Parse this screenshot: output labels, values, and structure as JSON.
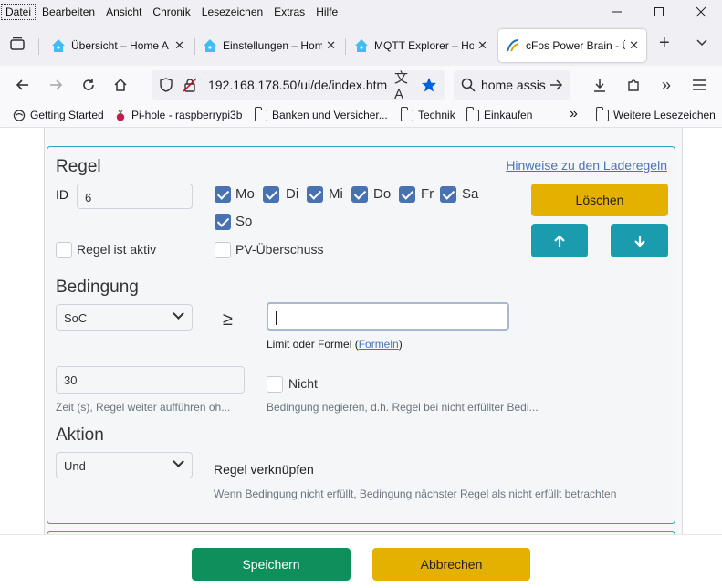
{
  "menu": [
    "Datei",
    "Bearbeiten",
    "Ansicht",
    "Chronik",
    "Lesezeichen",
    "Extras",
    "Hilfe"
  ],
  "tabs": [
    {
      "title": "Übersicht – Home A"
    },
    {
      "title": "Einstellungen – Hom"
    },
    {
      "title": "MQTT Explorer – Hor"
    },
    {
      "title": "cFos Power Brain - Ü"
    }
  ],
  "nav": {
    "url": "192.168.178.50/ui/de/index.htm",
    "search": "home assis"
  },
  "bookmarks": [
    {
      "label": "Getting Started",
      "icon": "firefox-icon"
    },
    {
      "label": "Pi-hole - raspberrypi3b",
      "icon": "raspberry-icon"
    },
    {
      "label": "Banken und Versicher...",
      "icon": "folder-icon"
    },
    {
      "label": "Technik",
      "icon": "folder-icon"
    },
    {
      "label": "Einkaufen",
      "icon": "folder-icon"
    },
    {
      "label": "Weitere Lesezeichen",
      "icon": "folder-icon"
    }
  ],
  "rule": {
    "heading": "Regel",
    "hint_link": "Hinweise zu den Laderegeln",
    "id_label": "ID",
    "id_value": "6",
    "days": [
      {
        "label": "Mo",
        "checked": true
      },
      {
        "label": "Di",
        "checked": true
      },
      {
        "label": "Mi",
        "checked": true
      },
      {
        "label": "Do",
        "checked": true
      },
      {
        "label": "Fr",
        "checked": true
      },
      {
        "label": "Sa",
        "checked": true
      },
      {
        "label": "So",
        "checked": true
      }
    ],
    "active_label": "Regel ist aktiv",
    "pv_label": "PV-Überschuss",
    "delete_label": "Löschen"
  },
  "condition": {
    "heading": "Bedingung",
    "select_value": "SoC",
    "operator": "≥",
    "limit_value": "",
    "limit_help_prefix": "Limit oder Formel (",
    "limit_help_link": "Formeln",
    "limit_help_suffix": ")",
    "time_value": "30",
    "time_help": "Zeit (s), Regel weiter aufführen oh...",
    "not_label": "Nicht",
    "not_help": "Bedingung negieren, d.h. Regel bei nicht erfüllter Bedi..."
  },
  "action": {
    "heading": "Aktion",
    "select_value": "Und",
    "link_label": "Regel verknüpfen",
    "link_help": "Wenn Bedingung nicht erfüllt, Bedingung nächster Regel als nicht erfüllt betrachten"
  },
  "footer": {
    "save_label": "Speichern",
    "cancel_label": "Abbrechen"
  },
  "colors": {
    "accent_warning": "#e5b100",
    "accent_teal": "#1b9bae",
    "accent_success": "#0f8f5c",
    "checkbox": "#4972b3",
    "card_border": "#2aa8b8"
  }
}
